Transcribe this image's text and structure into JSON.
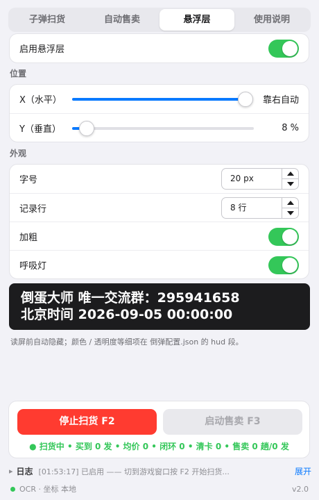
{
  "tabs": [
    {
      "label": "子弹扫货",
      "active": false
    },
    {
      "label": "自动售卖",
      "active": false
    },
    {
      "label": "悬浮层",
      "active": true
    },
    {
      "label": "使用说明",
      "active": false
    }
  ],
  "enable_overlay": {
    "label": "启用悬浮层",
    "on": true
  },
  "position": {
    "section_label": "位置",
    "x": {
      "label": "X（水平）",
      "value_text": "靠右自动",
      "fraction": 1.0
    },
    "y": {
      "label": "Y（垂直）",
      "value_text": "8 %",
      "fraction": 0.08
    }
  },
  "appearance": {
    "section_label": "外观",
    "font_size": {
      "label": "字号",
      "value": "20 px"
    },
    "log_rows": {
      "label": "记录行",
      "value": "8 行"
    },
    "bold": {
      "label": "加粗",
      "on": true
    },
    "breathing": {
      "label": "呼吸灯",
      "on": true
    }
  },
  "preview": {
    "line1": "倒蛋大师 唯一交流群：295941658",
    "line2": "北京时间 2026-09-05 00:00:00"
  },
  "note": "读屏前自动隐藏；颜色 / 透明度等细项在 倒弹配置.json 的 hud 段。",
  "controls": {
    "stop_label": "停止扫货  F2",
    "start_label": "启动售卖  F3",
    "status": "● 扫货中 • 买到 0 发 • 均价 0 • 闭环 0 • 清卡 0 • 售卖 0 趟/0 发"
  },
  "log": {
    "caret": "▸",
    "title": "日志",
    "text": "[01:53:17] 已启用 —— 切到游戏窗口按 F2 开始扫货...",
    "expand_label": "展开"
  },
  "footer": {
    "status": "OCR · 坐标 本地",
    "version": "v2.0"
  },
  "colors": {
    "accent": "#0a7aff",
    "toggle_on": "#34c759",
    "stop": "#ff3b30",
    "preview_bg": "#1c1c1e"
  }
}
